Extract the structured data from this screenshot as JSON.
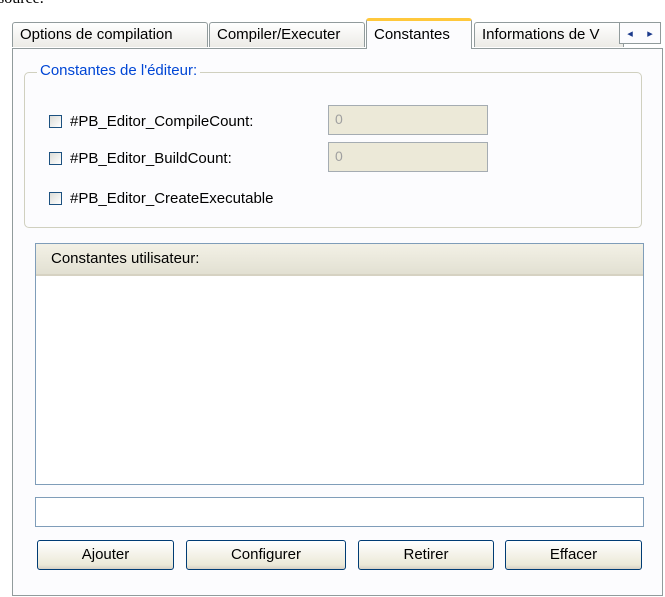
{
  "header_text": "source.",
  "tabs": [
    {
      "label": "Options de compilation",
      "active": false
    },
    {
      "label": "Compiler/Executer",
      "active": false
    },
    {
      "label": "Constantes",
      "active": true
    },
    {
      "label": "Informations de V",
      "active": false
    }
  ],
  "scroll_arrows": {
    "left": "◂",
    "right": "▸"
  },
  "editor_constants": {
    "title": "Constantes de l'éditeur:",
    "items": [
      {
        "label": "#PB_Editor_CompileCount:",
        "checked": false,
        "value": "0"
      },
      {
        "label": "#PB_Editor_BuildCount:",
        "checked": false,
        "value": "0"
      },
      {
        "label": "#PB_Editor_CreateExecutable",
        "checked": false
      }
    ]
  },
  "user_constants": {
    "column_header": "Constantes utilisateur:",
    "rows": []
  },
  "entry_value": "",
  "buttons": {
    "add": "Ajouter",
    "configure": "Configurer",
    "remove": "Retirer",
    "clear": "Effacer"
  }
}
